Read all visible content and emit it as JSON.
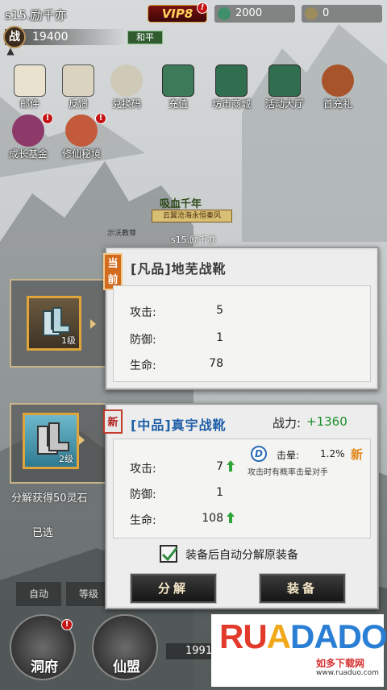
{
  "top": {
    "player_name": "s15.励千亦",
    "vip_label": "VIP8",
    "vip_badge": "!",
    "currency1": "2000",
    "currency2": "0",
    "power_icon_text": "战",
    "power_value": "19400",
    "peace_mode": "和平"
  },
  "menu_row1": [
    {
      "label": "邮件",
      "icon": "mail-icon"
    },
    {
      "label": "反馈",
      "icon": "feedback-icon"
    },
    {
      "label": "兑换码",
      "icon": "gift-code-icon"
    },
    {
      "label": "充值",
      "icon": "recharge-icon"
    },
    {
      "label": "坊市商城",
      "icon": "shop-icon"
    },
    {
      "label": "活动大厅",
      "icon": "event-hall-icon"
    },
    {
      "label": "首充礼",
      "icon": "first-recharge-icon"
    }
  ],
  "menu_row2": [
    {
      "label": "成长基金",
      "icon": "growth-fund-icon",
      "badge": "!"
    },
    {
      "label": "修仙秘境",
      "icon": "secret-realm-icon",
      "badge": "!"
    }
  ],
  "scene": {
    "banner_title": "吸血千年",
    "banner_sub": "云翼沧海永恒秦风",
    "left_name": "示沃教尊",
    "center_name": "s15.励千亦"
  },
  "current_item": {
    "tag": "当前",
    "title": "[凡品]地芜战靴",
    "slot_level": "1级",
    "stats": [
      {
        "label": "攻击:",
        "value": "5"
      },
      {
        "label": "防御:",
        "value": "1"
      },
      {
        "label": "生命:",
        "value": "78"
      }
    ]
  },
  "new_item": {
    "tag": "新",
    "title": "[中品]真宇战靴",
    "slot_level": "2级",
    "power_label": "战力:",
    "power_value": "+1360",
    "skill": {
      "icon_letter": "D",
      "name": "击晕:",
      "percent": "1.2%",
      "new_badge": "新",
      "desc": "攻击时有概率击晕对手"
    },
    "stats": [
      {
        "label": "攻击:",
        "value": "7",
        "up": true
      },
      {
        "label": "防御:",
        "value": "1",
        "up": false
      },
      {
        "label": "生命:",
        "value": "108",
        "up": true
      }
    ],
    "auto_decompose_label": "装备后自动分解原装备",
    "decompose_button": "分解",
    "equip_button": "装备"
  },
  "background_ui": {
    "hint": "分解获得50灵石",
    "hint2": "已选",
    "auto_button": "自动",
    "level_button": "等级",
    "home_label": "洞府",
    "alliance_label": "仙盟",
    "coin_value": "1991"
  },
  "watermark": {
    "logo": "RUANDADO",
    "sub": "如多下载网",
    "url": "www.ruaduo.com"
  }
}
